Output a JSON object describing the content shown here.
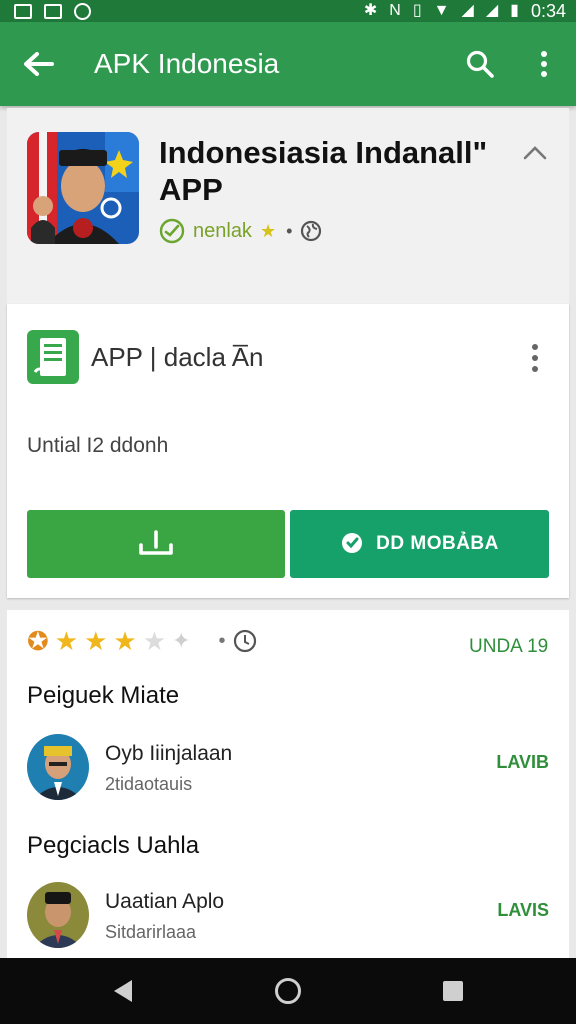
{
  "status_bar": {
    "time": "0:34",
    "left_icons": [
      "image-icon",
      "notification-icon",
      "circle-icon"
    ],
    "right_icons": [
      "bluetooth-icon",
      "nfc-icon",
      "vibrate-icon",
      "wifi-icon",
      "signal-icon",
      "signal-icon"
    ]
  },
  "app_bar": {
    "title": "APK Indonesia",
    "back_icon": "back-arrow-icon",
    "search_icon": "search-icon",
    "menu_icon": "more-vert-icon"
  },
  "app_header": {
    "title": "Indonesiasia Indanall\" APP",
    "developer": "nenlak",
    "dev_separator": "•",
    "collapse_icon": "chevron-up-icon"
  },
  "install_card": {
    "package_label": "APP | dacla A̅n",
    "subtitle": "Untial I2 ddonh",
    "install_icon": "download-icon",
    "open_label": "DD MOBẢBA"
  },
  "reviews": {
    "rating": 3.5,
    "rating_max": 5,
    "date_tag": "UNDA 19",
    "sections": [
      {
        "heading": "Peiguek Miate",
        "review": {
          "name": "Oyb Iiinjalaan",
          "sub": "2tidaotauis",
          "action": "LAVIB"
        }
      },
      {
        "heading": "Pegciacls Uahla",
        "review": {
          "name": "Uaatian Aplo",
          "sub": "Sitdarirlaaa",
          "action": "LAVIS"
        }
      }
    ]
  },
  "nav_bar": {
    "back": "nav-back-icon",
    "home": "nav-home-icon",
    "recents": "nav-recents-icon"
  },
  "colors": {
    "status_bar": "#1f7a3a",
    "app_bar": "#2f9a4f",
    "install_button": "#3aa543",
    "open_button": "#16a06a",
    "accent_text": "#2f8f3a"
  }
}
